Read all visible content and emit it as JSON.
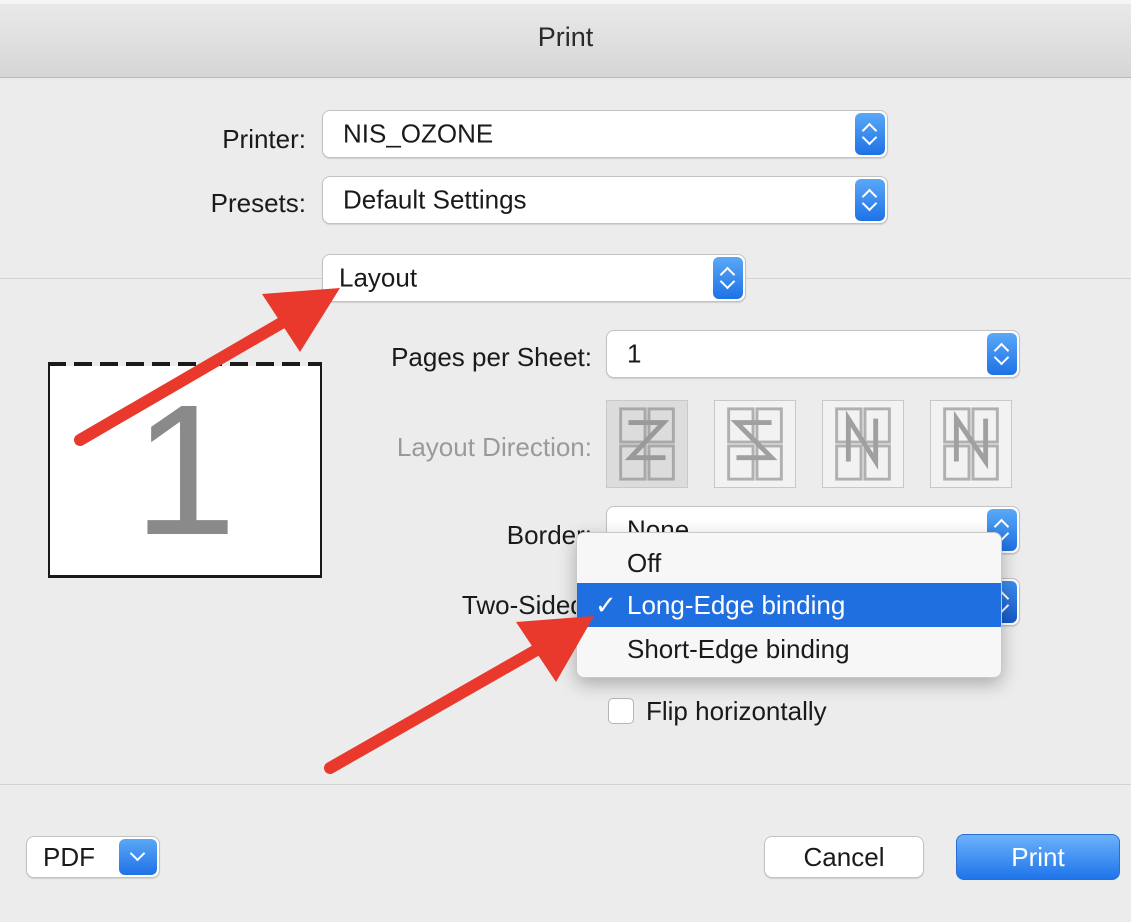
{
  "window": {
    "title": "Print"
  },
  "printer": {
    "label": "Printer:",
    "value": "NIS_OZONE"
  },
  "presets": {
    "label": "Presets:",
    "value": "Default Settings"
  },
  "section": {
    "value": "Layout"
  },
  "preview": {
    "page_number": "1"
  },
  "pages_per_sheet": {
    "label": "Pages per Sheet:",
    "value": "1"
  },
  "layout_direction": {
    "label": "Layout Direction:",
    "icons": [
      "z-direction-icon",
      "s-direction-icon",
      "n-reverse-direction-icon",
      "n-direction-icon"
    ]
  },
  "border": {
    "label": "Border:",
    "value": "None"
  },
  "two_sided": {
    "label": "Two-Sided:",
    "options": [
      "Off",
      "Long-Edge binding",
      "Short-Edge binding"
    ],
    "selected": "Long-Edge binding",
    "check": "✓"
  },
  "checkboxes": {
    "flip_horizontally": "Flip horizontally"
  },
  "buttons": {
    "pdf": "PDF",
    "cancel": "Cancel",
    "print": "Print"
  },
  "colors": {
    "accent": "#1f6fe0",
    "annotation_arrow": "#e8392c"
  }
}
